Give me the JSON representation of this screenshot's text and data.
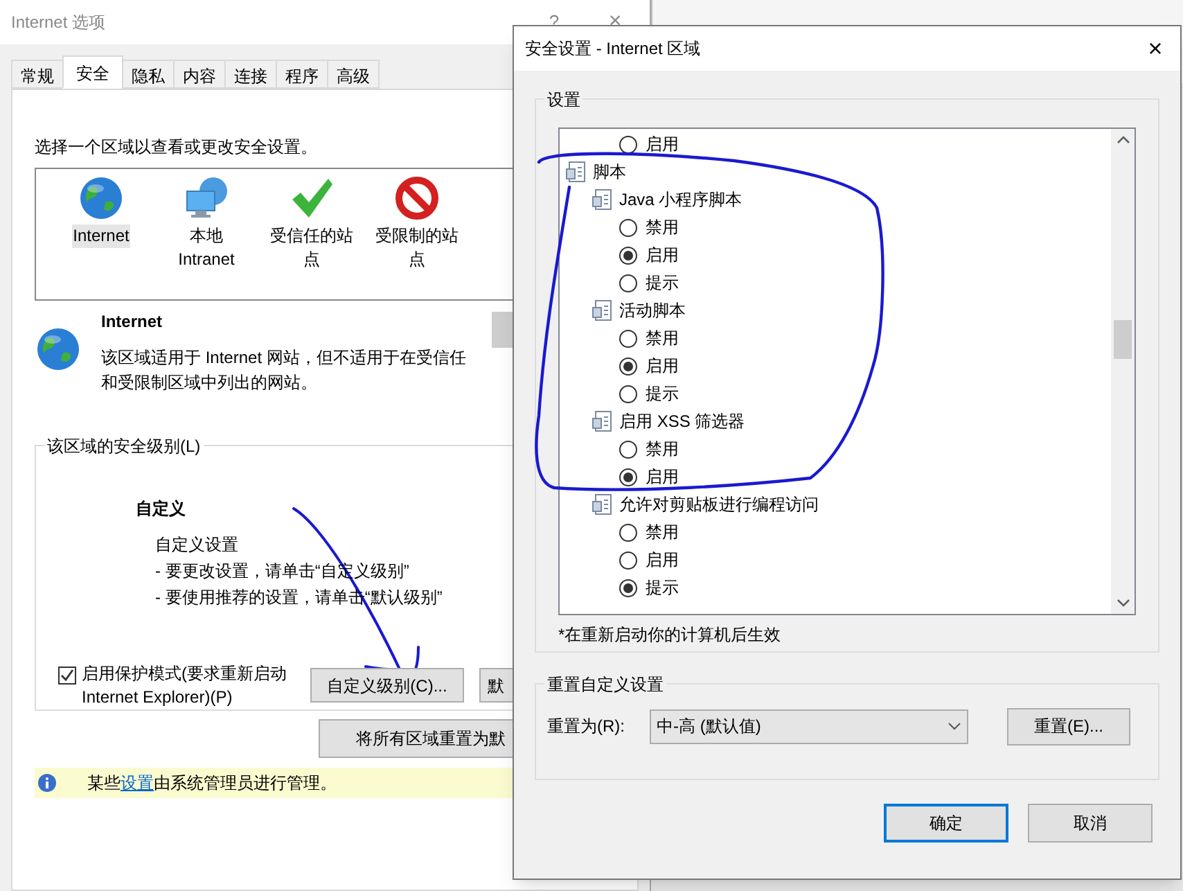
{
  "back_window": {
    "title": "Internet 选项",
    "help": "?",
    "close": "×",
    "tabs": [
      {
        "label": "常规",
        "selected": false
      },
      {
        "label": "安全",
        "selected": true
      },
      {
        "label": "隐私",
        "selected": false
      },
      {
        "label": "内容",
        "selected": false
      },
      {
        "label": "连接",
        "selected": false
      },
      {
        "label": "程序",
        "selected": false
      },
      {
        "label": "高级",
        "selected": false
      }
    ],
    "zone_prompt": "选择一个区域以查看或更改安全设置。",
    "zones": [
      {
        "kind": "globe",
        "label": "Internet",
        "selected": true
      },
      {
        "kind": "intranet",
        "label": "本地 Intranet",
        "selected": false
      },
      {
        "kind": "trusted",
        "label": "受信任的站点",
        "selected": false
      },
      {
        "kind": "restricted",
        "label": "受限制的站点",
        "selected": false
      }
    ],
    "zone_title": "Internet",
    "zone_description": "该区域适用于 Internet 网站，但不适用于在受信任和受限制区域中列出的网站。",
    "level_group": "该区域的安全级别(L)",
    "level_name": "自定义",
    "level_lines": [
      "自定义设置",
      "- 要更改设置，请单击“自定义级别”",
      "- 要使用推荐的设置，请单击“默认级别”"
    ],
    "protected_mode": {
      "label": "启用保护模式(要求重新启动 Internet Explorer)(P)",
      "checked": true
    },
    "custom_level_button": "自定义级别(C)...",
    "default_level_button": "默",
    "reset_all_button": "将所有区域重置为默",
    "info": {
      "before": "某些",
      "link": "设置",
      "after": "由系统管理员进行管理。"
    }
  },
  "dialog": {
    "title": "安全设置 - Internet 区域",
    "close": "×",
    "settings_group": "设置",
    "tree": [
      {
        "kind": "option",
        "label": "启用",
        "selected": false
      },
      {
        "kind": "category",
        "label": "脚本",
        "children": [
          {
            "kind": "setting",
            "label": "Java 小程序脚本",
            "children": [
              {
                "kind": "option",
                "label": "禁用",
                "selected": false
              },
              {
                "kind": "option",
                "label": "启用",
                "selected": true
              },
              {
                "kind": "option",
                "label": "提示",
                "selected": false
              }
            ]
          },
          {
            "kind": "setting",
            "label": "活动脚本",
            "children": [
              {
                "kind": "option",
                "label": "禁用",
                "selected": false
              },
              {
                "kind": "option",
                "label": "启用",
                "selected": true
              },
              {
                "kind": "option",
                "label": "提示",
                "selected": false
              }
            ]
          },
          {
            "kind": "setting",
            "label": "启用 XSS 筛选器",
            "children": [
              {
                "kind": "option",
                "label": "禁用",
                "selected": false
              },
              {
                "kind": "option",
                "label": "启用",
                "selected": true
              }
            ]
          },
          {
            "kind": "setting",
            "label": "允许对剪贴板进行编程访问",
            "children": [
              {
                "kind": "option",
                "label": "禁用",
                "selected": false
              },
              {
                "kind": "option",
                "label": "启用",
                "selected": false
              },
              {
                "kind": "option",
                "label": "提示",
                "selected": true
              }
            ]
          }
        ]
      }
    ],
    "restart_note": "*在重新启动你的计算机后生效",
    "reset_group": "重置自定义设置",
    "reset_label": "重置为(R):",
    "reset_value": "中-高 (默认值)",
    "reset_button": "重置(E)...",
    "ok": "确定",
    "cancel": "取消"
  }
}
